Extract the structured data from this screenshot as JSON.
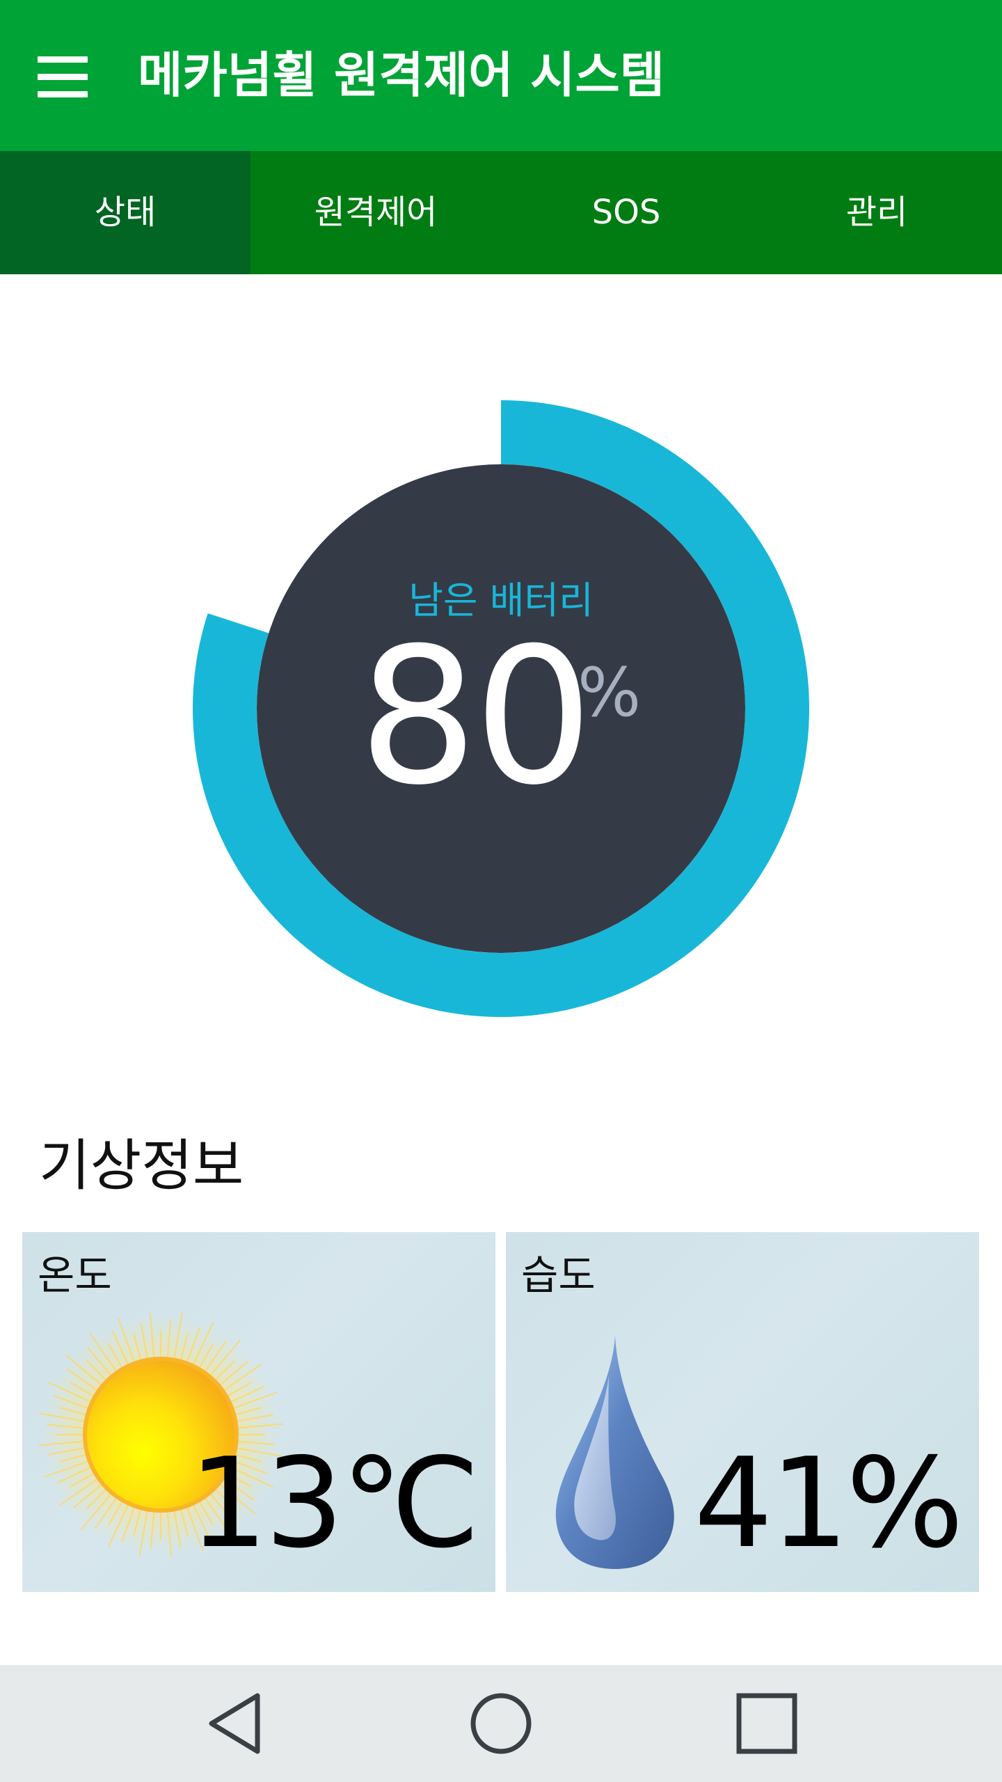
{
  "app_bar": {
    "title": "메카넘휠 원격제어 시스템",
    "menu_icon": "hamburger-menu-icon",
    "color": "#00a335"
  },
  "tabs": {
    "color": "#017c12",
    "active_color": "#026523",
    "items": [
      {
        "label": "상태",
        "active": true
      },
      {
        "label": "원격제어",
        "active": false
      },
      {
        "label": "SOS",
        "active": false
      },
      {
        "label": "관리",
        "active": false
      }
    ]
  },
  "battery": {
    "label": "남은 배터리",
    "value": "80",
    "unit": "%",
    "percent": 80,
    "ring_color": "#18b7d8",
    "center_color": "#343b47"
  },
  "weather": {
    "title": "기상정보",
    "temperature": {
      "label": "온도",
      "value": "13℃",
      "icon": "sun-icon"
    },
    "humidity": {
      "label": "습도",
      "value": "41%",
      "icon": "water-drop-icon"
    }
  },
  "nav_bar": {
    "icons": [
      "back-triangle-icon",
      "home-circle-icon",
      "recent-apps-square-icon"
    ]
  }
}
